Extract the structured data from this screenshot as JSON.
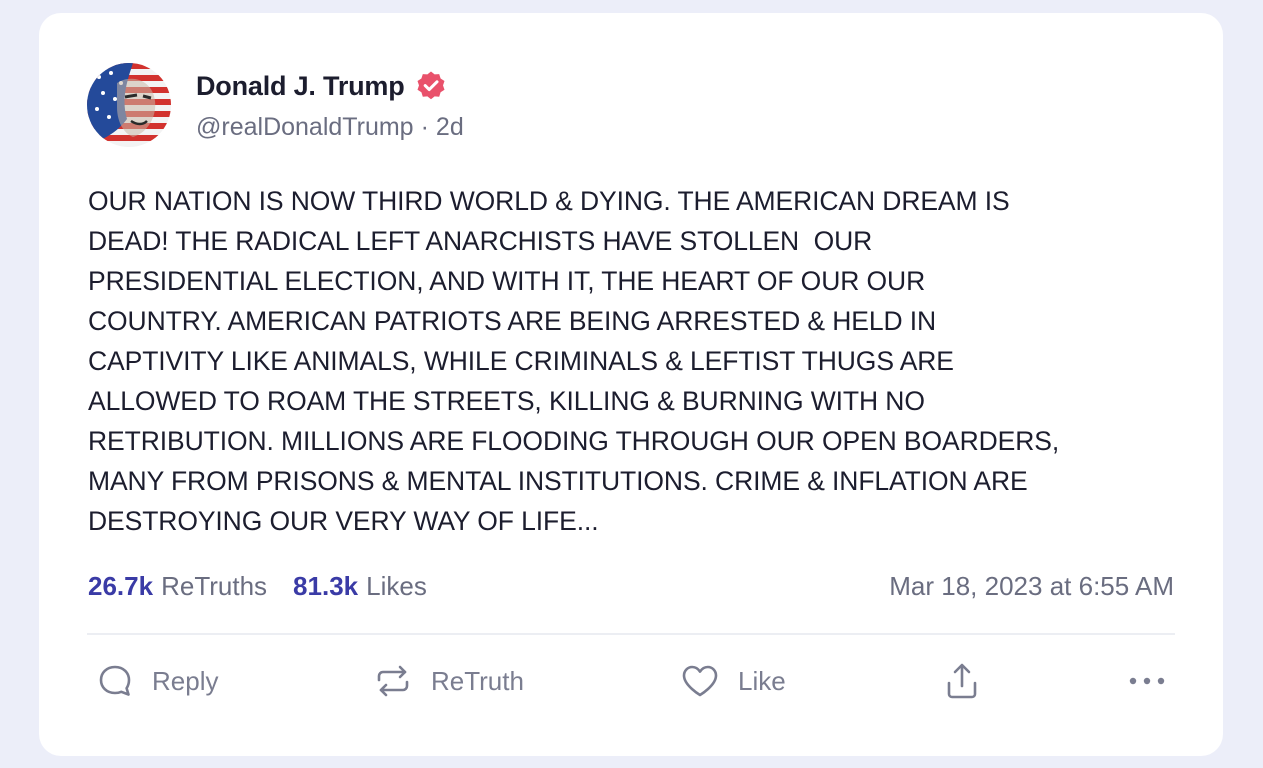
{
  "post": {
    "author": {
      "display_name": "Donald J. Trump",
      "handle": "@realDonaldTrump",
      "separator": "·",
      "age": "2d",
      "verified_icon": "verified-badge-icon",
      "verified_color": "#e9516b"
    },
    "text": "OUR NATION IS NOW THIRD WORLD & DYING. THE AMERICAN DREAM IS\nDEAD! THE RADICAL LEFT ANARCHISTS HAVE STOLLEN  OUR\nPRESIDENTIAL ELECTION, AND WITH IT, THE HEART OF OUR OUR\nCOUNTRY. AMERICAN PATRIOTS ARE BEING ARRESTED & HELD IN\nCAPTIVITY LIKE ANIMALS, WHILE CRIMINALS & LEFTIST THUGS ARE\nALLOWED TO ROAM THE STREETS, KILLING & BURNING WITH NO\nRETRIBUTION. MILLIONS ARE FLOODING THROUGH OUR OPEN BOARDERS,\nMANY FROM PRISONS & MENTAL INSTITUTIONS. CRIME & INFLATION ARE\nDESTROYING OUR VERY WAY OF LIFE...",
    "stats": {
      "retruths_count": "26.7k",
      "retruths_label": "ReTruths",
      "likes_count": "81.3k",
      "likes_label": "Likes"
    },
    "timestamp": "Mar 18, 2023 at 6:55 AM"
  },
  "actions": {
    "reply": {
      "label": "Reply",
      "icon": "reply-bubble-icon"
    },
    "retruth": {
      "label": "ReTruth",
      "icon": "retruth-arrows-icon"
    },
    "like": {
      "label": "Like",
      "icon": "heart-icon"
    },
    "share": {
      "icon": "share-icon"
    },
    "more": {
      "icon": "more-options-icon"
    }
  },
  "colors": {
    "accent_count": "#3a3ba6",
    "muted_text": "#6a6d80",
    "body_text": "#1c1d2e",
    "page_background": "#eceef9"
  }
}
